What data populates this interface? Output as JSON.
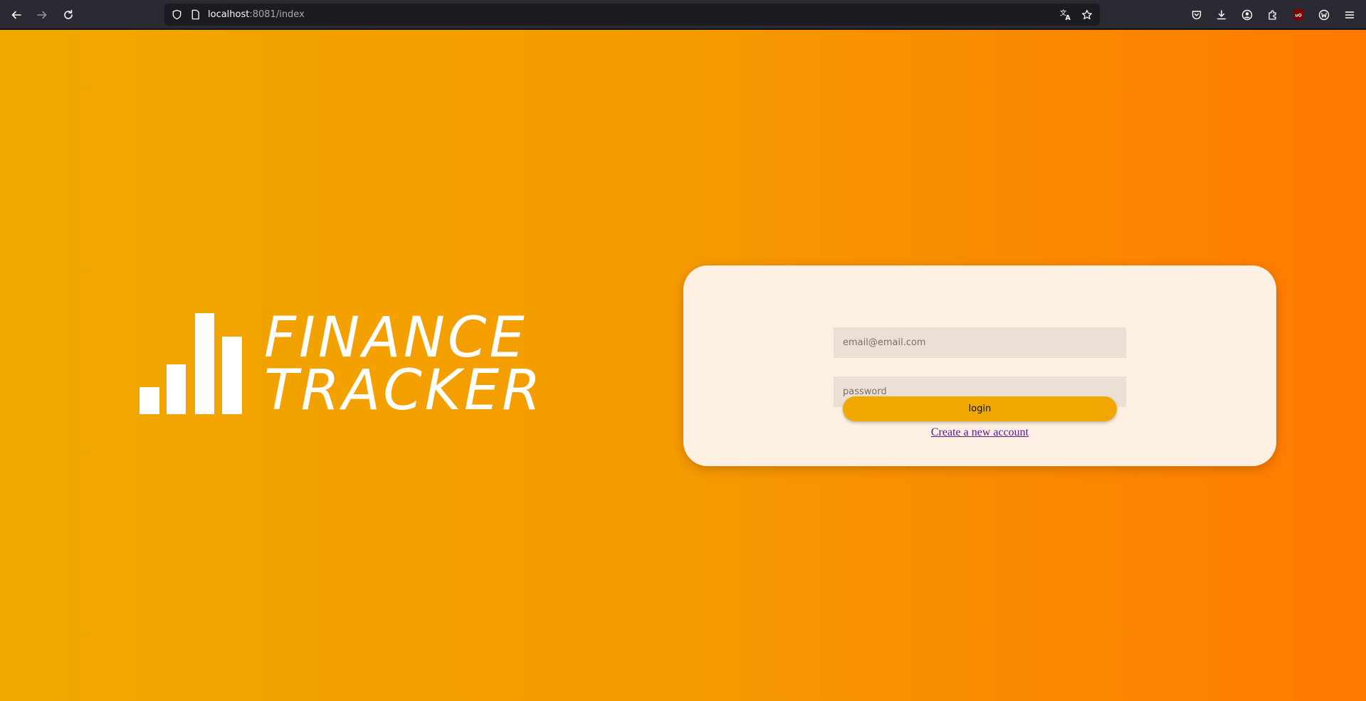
{
  "browser": {
    "url_host": "localhost",
    "url_rest": ":8081/index",
    "icons": {
      "back": "back-arrow-icon",
      "forward": "forward-arrow-icon",
      "reload": "reload-icon",
      "shield": "tracking-shield-icon",
      "page": "page-icon",
      "translate": "translate-icon",
      "bookmark": "bookmark-star-icon",
      "pocket": "pocket-icon",
      "downloads": "downloads-icon",
      "account": "account-icon",
      "extensions": "extensions-icon",
      "ublock": "ublock-origin-icon",
      "extension2": "extension-badge-icon",
      "menu": "hamburger-menu-icon"
    },
    "ublock_label": "uO"
  },
  "logo": {
    "line1": "FINANCE",
    "line2": "TRACKER",
    "icon": "bar-chart-icon"
  },
  "login": {
    "email_placeholder": "email@email.com",
    "password_placeholder": "password",
    "login_label": "login",
    "create_account_label": "Create a new account"
  },
  "colors": {
    "gradient_start": "#f0a800",
    "gradient_end": "#ff7a00",
    "card_bg": "#fdf0e3",
    "field_bg": "#ecdfd3",
    "button_bg": "#f0a800",
    "link": "#551a8b"
  }
}
